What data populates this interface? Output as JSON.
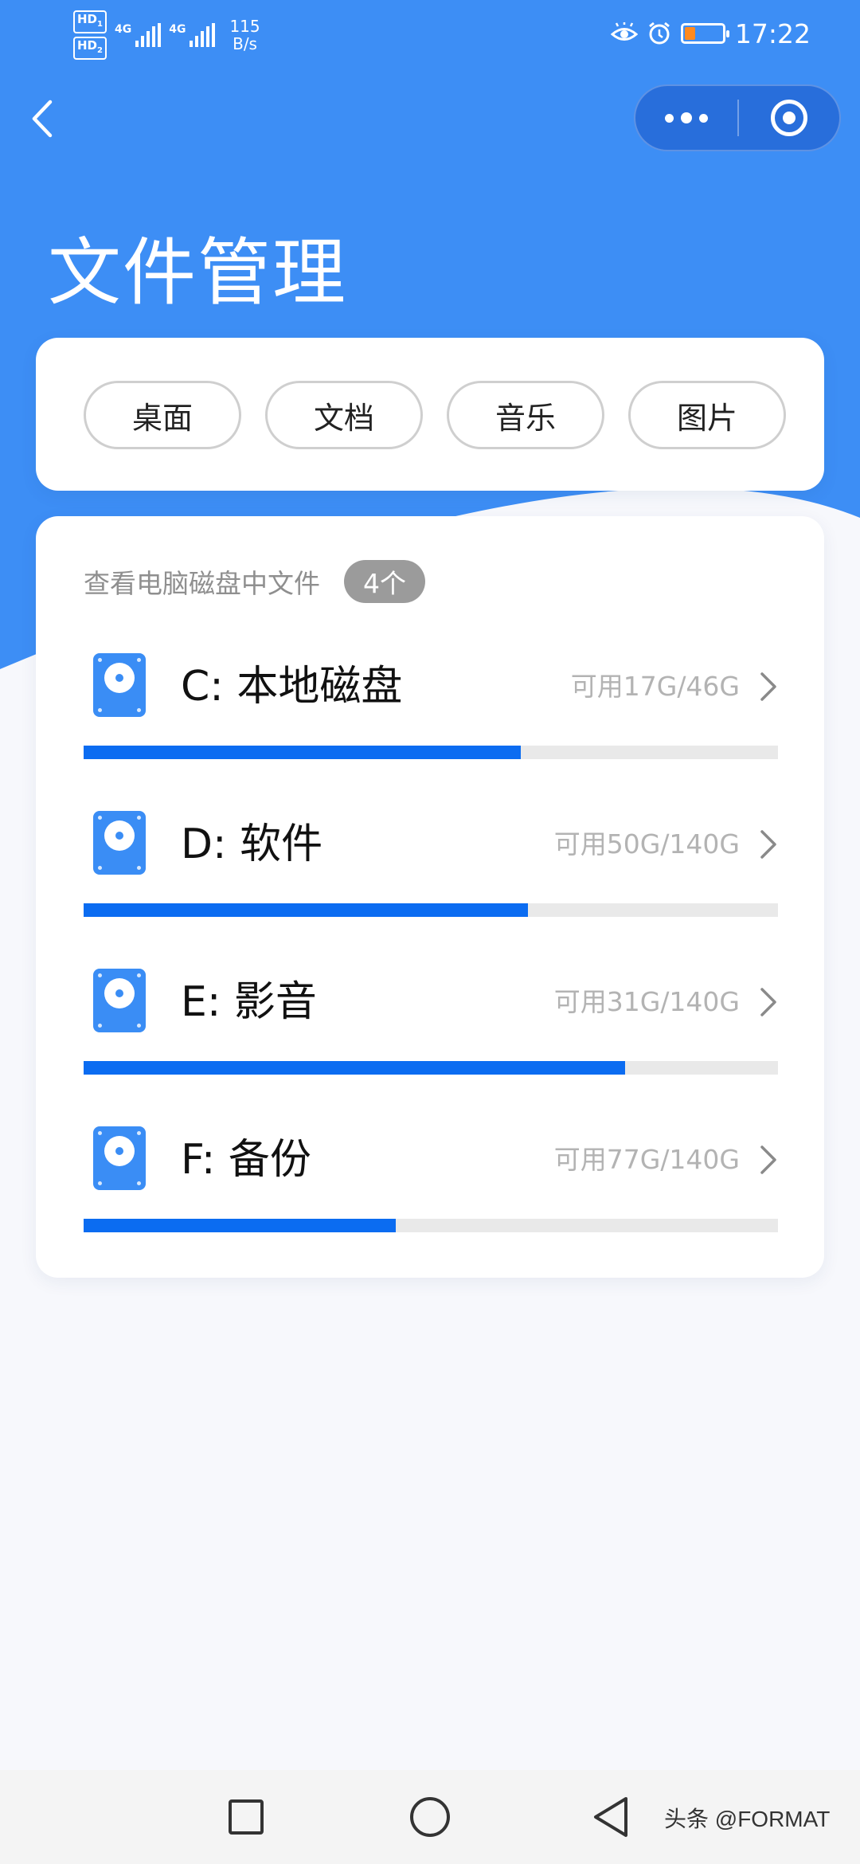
{
  "status_bar": {
    "hd1": "HD",
    "hd1_sub": "1",
    "hd2": "HD",
    "hd2_sub": "2",
    "net1": "4G",
    "net2": "4G",
    "speed_value": "115",
    "speed_unit": "B/s",
    "time": "17:22",
    "battery_level": 0.28,
    "icons": [
      "eye-comfort-icon",
      "alarm-icon",
      "battery-icon"
    ]
  },
  "nav": {
    "back_icon": "back-arrow-icon",
    "capsule_more_icon": "more-dots-icon",
    "capsule_close_icon": "target-close-icon"
  },
  "page": {
    "title": "文件管理"
  },
  "categories": [
    {
      "label": "桌面"
    },
    {
      "label": "文档"
    },
    {
      "label": "音乐"
    },
    {
      "label": "图片"
    }
  ],
  "disks_card": {
    "subtitle": "查看电脑磁盘中文件",
    "count_badge": "4个",
    "disks": [
      {
        "name": "C: 本地磁盘",
        "free_text": "可用17G/46G",
        "used_fraction": 0.63
      },
      {
        "name": "D: 软件",
        "free_text": "可用50G/140G",
        "used_fraction": 0.64
      },
      {
        "name": "E: 影音",
        "free_text": "可用31G/140G",
        "used_fraction": 0.78
      },
      {
        "name": "F: 备份",
        "free_text": "可用77G/140G",
        "used_fraction": 0.45
      }
    ]
  },
  "system_nav": {
    "recent_icon": "square-recents-icon",
    "home_icon": "circle-home-icon",
    "back_icon": "triangle-back-icon"
  },
  "watermark": "头条 @FORMAT",
  "colors": {
    "header_blue": "#3d8ef5",
    "progress_blue": "#0b6cf1",
    "track_gray": "#e9e9e9",
    "disk_icon_blue": "#3a8df5",
    "badge_gray": "#9b9b9b"
  }
}
